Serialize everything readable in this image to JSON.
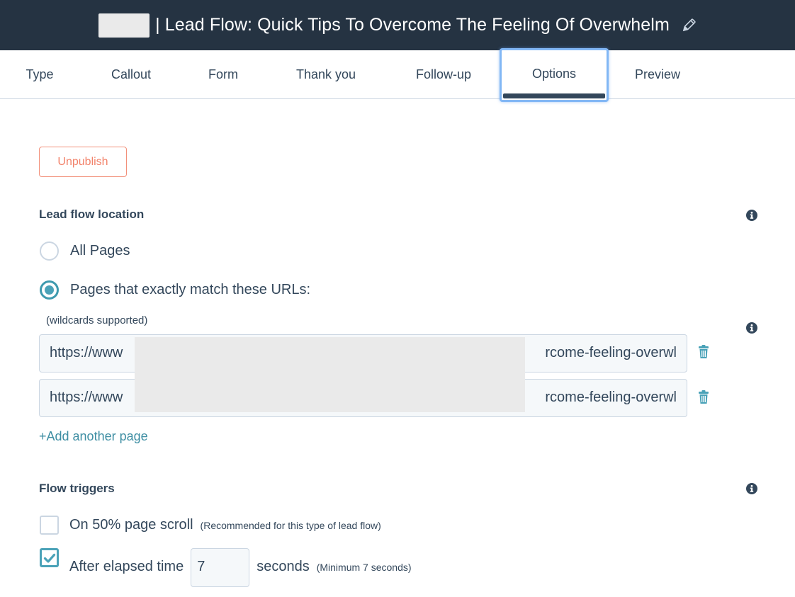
{
  "header": {
    "title": "| Lead Flow: Quick Tips To Overcome The Feeling Of Overwhelm",
    "edit_icon": "pencil-icon",
    "background_color": "#253342"
  },
  "tabs": [
    {
      "label": "Type",
      "active": false
    },
    {
      "label": "Callout",
      "active": false
    },
    {
      "label": "Form",
      "active": false
    },
    {
      "label": "Thank you",
      "active": false
    },
    {
      "label": "Follow-up",
      "active": false
    },
    {
      "label": "Options",
      "active": true
    },
    {
      "label": "Preview",
      "active": false
    }
  ],
  "actions": {
    "unpublish_label": "Unpublish",
    "unpublish_color": "#f2826a"
  },
  "location": {
    "label": "Lead flow location",
    "options": [
      {
        "label": "All Pages",
        "selected": false
      },
      {
        "label": "Pages that exactly match these URLs:",
        "selected": true
      }
    ],
    "hint": "(wildcards supported)",
    "urls": [
      {
        "prefix": "https://www",
        "suffix": "rcome-feeling-overwl"
      },
      {
        "prefix": "https://www",
        "suffix": "rcome-feeling-overwl"
      }
    ],
    "add_label": "+Add another page",
    "accent_color": "#4aa2b8"
  },
  "triggers": {
    "label": "Flow triggers",
    "scroll": {
      "label": "On 50% page scroll",
      "note": "(Recommended for this type of lead flow)",
      "checked": false
    },
    "time": {
      "label": "After elapsed time",
      "value": "7",
      "unit": "seconds",
      "note": "(Minimum 7 seconds)",
      "checked": true
    }
  }
}
